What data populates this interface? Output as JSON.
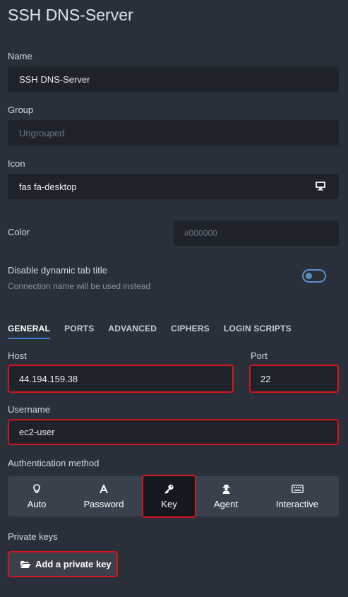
{
  "page_title": "SSH DNS-Server",
  "fields": {
    "name": {
      "label": "Name",
      "value": "SSH DNS-Server"
    },
    "group": {
      "label": "Group",
      "placeholder": "Ungrouped"
    },
    "icon": {
      "label": "Icon",
      "value": "fas fa-desktop",
      "icon": "desktop-icon"
    },
    "color": {
      "label": "Color",
      "placeholder": "#000000"
    }
  },
  "dynamic_tab": {
    "label": "Disable dynamic tab title",
    "note": "Connection name will be used instead",
    "enabled": false
  },
  "tabs": [
    {
      "label": "GENERAL",
      "active": true
    },
    {
      "label": "PORTS"
    },
    {
      "label": "ADVANCED"
    },
    {
      "label": "CIPHERS"
    },
    {
      "label": "LOGIN SCRIPTS"
    }
  ],
  "general": {
    "host": {
      "label": "Host",
      "value": "44.194.159.38"
    },
    "port": {
      "label": "Port",
      "value": "22"
    },
    "username": {
      "label": "Username",
      "value": "ec2-user"
    },
    "auth_method": {
      "label": "Authentication method",
      "options": [
        {
          "label": "Auto",
          "icon": "lightbulb-icon"
        },
        {
          "label": "Password",
          "icon": "font-icon"
        },
        {
          "label": "Key",
          "icon": "key-icon",
          "selected": true
        },
        {
          "label": "Agent",
          "icon": "user-secret-icon"
        },
        {
          "label": "Interactive",
          "icon": "keyboard-icon"
        }
      ]
    },
    "private_keys": {
      "label": "Private keys",
      "add_button": "Add a private key",
      "icon": "folder-open-icon"
    }
  },
  "colors": {
    "background": "#2a303a",
    "input": "#1e232b",
    "highlight": "#d7141a",
    "accent": "#3c82d8"
  }
}
